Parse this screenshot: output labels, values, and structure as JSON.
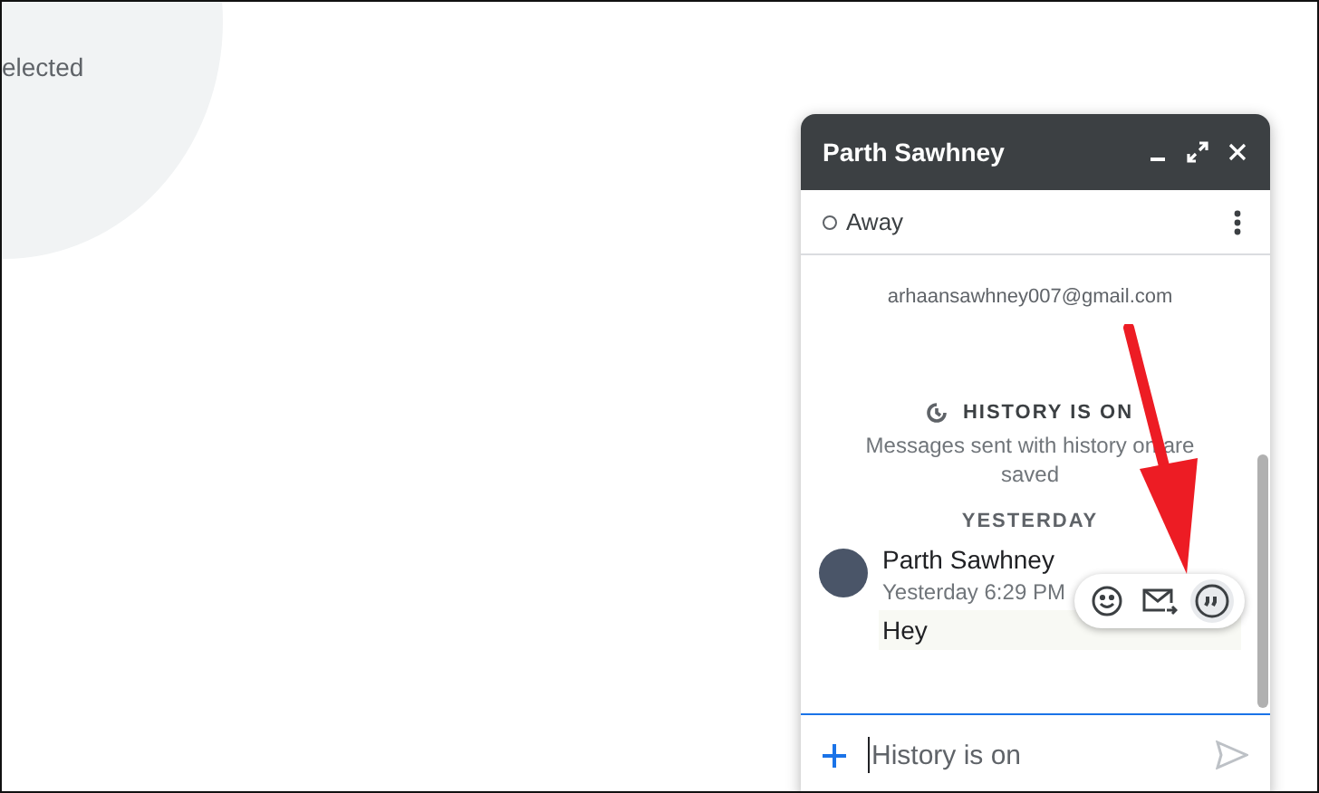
{
  "background": {
    "partial_text": "elected"
  },
  "chat": {
    "title": "Parth Sawhney",
    "status": {
      "label": "Away",
      "online": false
    },
    "email": "arhaansawhney007@gmail.com",
    "history_title": "HISTORY IS ON",
    "history_note": "Messages sent with history on are saved",
    "day_label": "YESTERDAY",
    "messages": [
      {
        "sender": "Parth Sawhney",
        "time": "Yesterday 6:29 PM",
        "text": "Hey",
        "hovered": true
      }
    ],
    "input": {
      "placeholder": "History is on"
    }
  }
}
